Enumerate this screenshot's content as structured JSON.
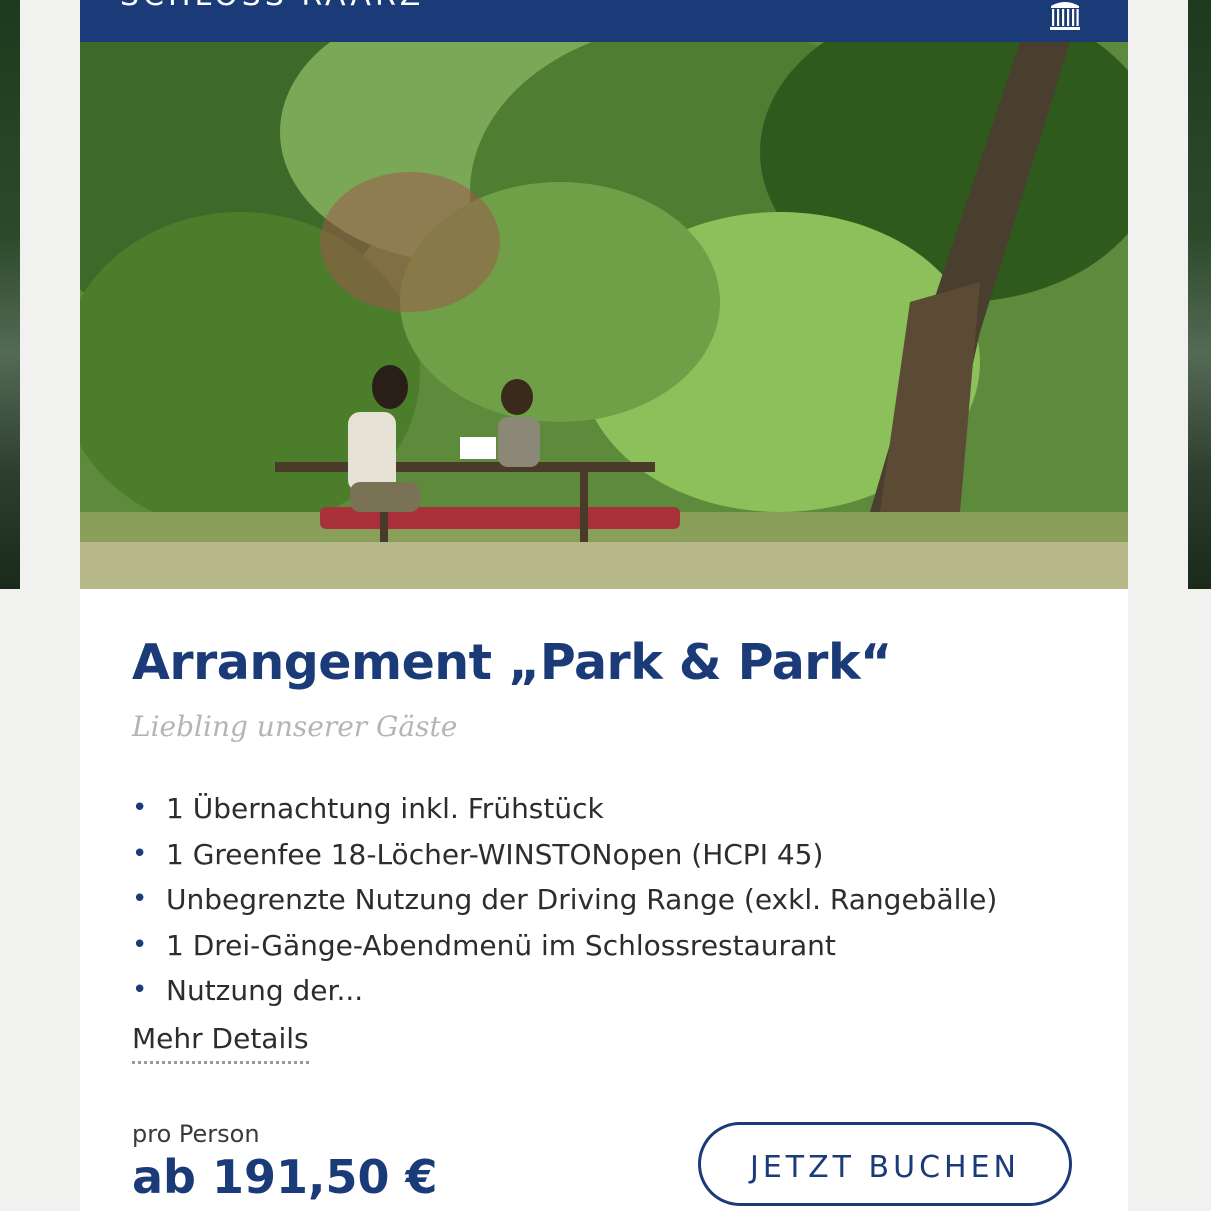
{
  "brand": {
    "name": "SCHLOSS RAARZ"
  },
  "offer": {
    "title": "Arrangement „Park & Park“",
    "subtitle": "Liebling unserer Gäste",
    "features": [
      "1 Übernachtung inkl. Frühstück",
      "1 Greenfee 18-Löcher-WINSTONopen (HCPI 45)",
      "Unbegrenzte Nutzung der Driving Range (exkl. Rangebälle)",
      "1 Drei-Gänge-Abendmenü im Schlossrestaurant",
      "Nutzung der..."
    ],
    "more_details": "Mehr Details",
    "price_label": "pro Person",
    "price": "ab 191,50 €",
    "book_button": "JETZT BUCHEN"
  },
  "colors": {
    "brand_blue": "#1a3a78",
    "subtitle_gray": "#b5b5b5",
    "text": "#2d2d2d"
  },
  "icons": {
    "logo": "castle-icon"
  }
}
